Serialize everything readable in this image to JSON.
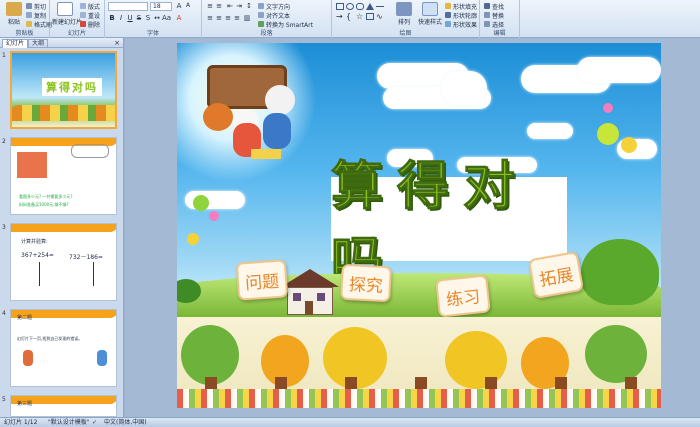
{
  "ribbon": {
    "groups": {
      "clipboard": "剪贴板",
      "slides": "幻灯片",
      "font": "字体",
      "paragraph": "段落",
      "drawing": "绘图",
      "editing": "编辑"
    },
    "paste": "粘贴",
    "cut": "剪切",
    "copy": "复制",
    "format_painter": "格式刷",
    "new_slide": "新建幻灯片",
    "layout": "版式",
    "reset": "重设",
    "delete": "删除",
    "font_size": "18",
    "text_direction": "文字方向",
    "align_text": "对齐文本",
    "convert_smartart": "转换为 SmartArt",
    "arrange": "排列",
    "quick_styles": "快速样式",
    "shape_fill": "形状填充",
    "shape_outline": "形状轮廓",
    "shape_effects": "形状效果",
    "find": "查找",
    "replace": "替换",
    "select": "选择"
  },
  "pane": {
    "tab_slides": "幻灯片",
    "tab_outline": "大纲",
    "thumbs": [
      {
        "num": "1",
        "title": "算得对吗"
      },
      {
        "num": "2",
        "q1": "看图多少元? 一共需要多少元?",
        "q2": "妈妈准备买1000元,够不够?"
      },
      {
        "num": "3",
        "heading": "计算并验算:",
        "expr1": "367+254=",
        "expr2": "732－186="
      },
      {
        "num": "4",
        "heading": "第二题",
        "text": "幻灯片下一页,找到自己发现的错误。"
      },
      {
        "num": "5",
        "heading": "第三题"
      }
    ]
  },
  "slide": {
    "title": "算得对吗",
    "tags": [
      "问题",
      "探究",
      "练习",
      "拓展"
    ]
  },
  "status": {
    "slide_info": "幻灯片 1/12",
    "theme": "\"默认设计模板\"",
    "language": "中文(简体,中国)"
  },
  "colors": {
    "title_green": "#8dc21f",
    "tag_orange": "#e6872a",
    "selection": "#f3a93a"
  }
}
